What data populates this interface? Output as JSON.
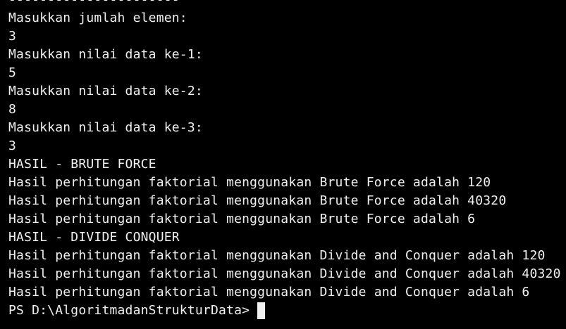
{
  "terminal": {
    "lines": [
      "----------------------",
      "Masukkan jumlah elemen:",
      "3",
      "Masukkan nilai data ke-1:",
      "5",
      "Masukkan nilai data ke-2:",
      "8",
      "Masukkan nilai data ke-3:",
      "3",
      "HASIL - BRUTE FORCE",
      "Hasil perhitungan faktorial menggunakan Brute Force adalah 120",
      "Hasil perhitungan faktorial menggunakan Brute Force adalah 40320",
      "Hasil perhitungan faktorial menggunakan Brute Force adalah 6",
      "HASIL - DIVIDE CONQUER",
      "Hasil perhitungan faktorial menggunakan Divide and Conquer adalah 120",
      "Hasil perhitungan faktorial menggunakan Divide and Conquer adalah 40320",
      "Hasil perhitungan faktorial menggunakan Divide and Conquer adalah 6"
    ],
    "prompt": "PS D:\\AlgoritmadanStrukturData>"
  },
  "colors": {
    "background": "#000000",
    "text": "#f0f0f0"
  }
}
